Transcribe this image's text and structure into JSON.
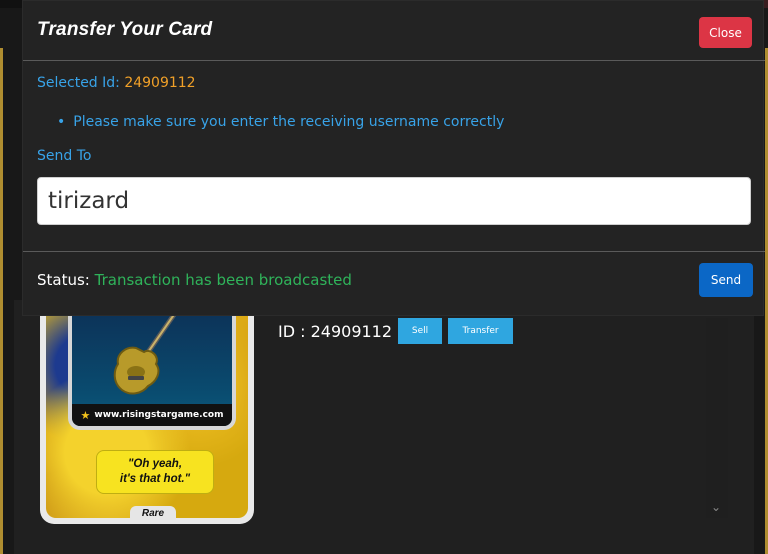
{
  "modal": {
    "title": "Transfer Your Card",
    "close_label": "Close",
    "selected_label": "Selected Id:",
    "selected_id": "24909112",
    "notice": "Please make sure you enter the receiving username correctly",
    "send_to_label": "Send To",
    "username_value": "tirizard",
    "status_label": "Status:",
    "status_value": "Transaction has been broadcasted",
    "send_label": "Send"
  },
  "card": {
    "url": "www.risingstargame.com",
    "quote_line1": "\"Oh yeah,",
    "quote_line2": "it's that hot.\"",
    "rarity": "Rare",
    "id_text": "ID : 24909112",
    "sell_label": "Sell",
    "transfer_label": "Transfer"
  },
  "icons": {
    "guitar": "guitar-icon",
    "star": "star-icon",
    "bullet": "bullet-icon",
    "scroll": "chevron-down-icon"
  },
  "colors": {
    "accent_blue": "#38a3e8",
    "selected_id": "#f0a028",
    "status_green": "#2fb35a",
    "close_red": "#dc3545",
    "send_blue": "#0b67c6"
  }
}
